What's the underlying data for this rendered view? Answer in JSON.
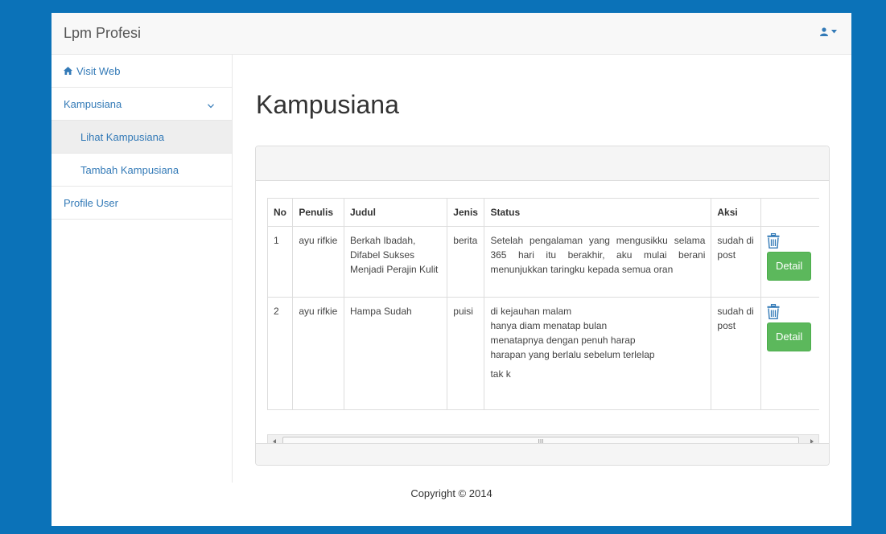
{
  "navbar": {
    "brand": "Lpm Profesi"
  },
  "sidebar": {
    "items": [
      {
        "label": "Visit Web"
      },
      {
        "label": "Kampusiana"
      },
      {
        "label": "Lihat Kampusiana"
      },
      {
        "label": "Tambah Kampusiana"
      },
      {
        "label": "Profile User"
      }
    ]
  },
  "main": {
    "title": "Kampusiana",
    "table": {
      "headers": [
        "No",
        "Penulis",
        "Judul",
        "Jenis",
        "Status",
        "Aksi",
        ""
      ],
      "rows": [
        {
          "no": "1",
          "penulis": "ayu rifkie",
          "judul": "Berkah Ibadah, Difabel Sukses Menjadi Perajin Kulit",
          "jenis": "berita",
          "status_lines": [
            "Setelah pengalaman yang mengusikku selama 365 hari itu berakhir, aku mulai berani menunjukkan taringku kepada semua oran"
          ],
          "aksi": "sudah di post",
          "detail_label": "Detail"
        },
        {
          "no": "2",
          "penulis": "ayu rifkie",
          "judul": "Hampa Sudah",
          "jenis": "puisi",
          "status_lines": [
            "di kejauhan malam",
            "hanya diam menatap bulan",
            "menatapnya dengan penuh harap",
            "harapan yang berlalu sebelum terlelap",
            "tak k"
          ],
          "aksi": "sudah di post",
          "detail_label": "Detail"
        }
      ]
    },
    "scrollbar_grip": "III"
  },
  "footer": {
    "copyright": "Copyright © 2014"
  },
  "colors": {
    "background": "#0b72b8",
    "link": "#337ab7",
    "success": "#5cb85c",
    "trash_icon": "#337ab7"
  }
}
